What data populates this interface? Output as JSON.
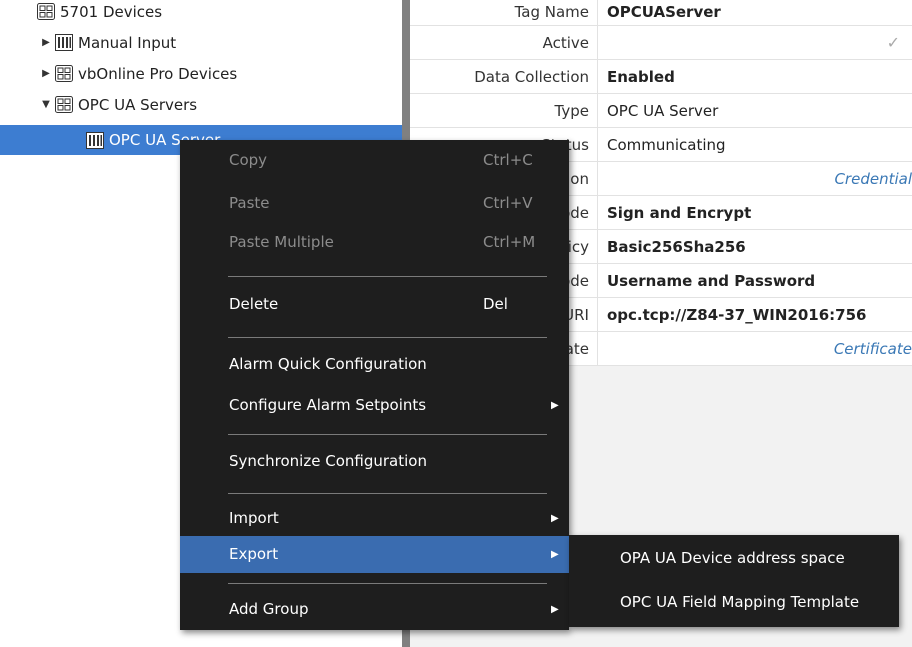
{
  "tree": {
    "items": [
      {
        "label": "5701 Devices",
        "arrow": "",
        "icon": "grid-device-icon"
      },
      {
        "label": "Manual Input",
        "arrow": "▶",
        "icon": "rack-device-icon"
      },
      {
        "label": "vbOnline Pro Devices",
        "arrow": "▶",
        "icon": "grid-device-icon"
      },
      {
        "label": "OPC UA Servers",
        "arrow": "▼",
        "icon": "grid-device-icon"
      },
      {
        "label": "OPC UA Server",
        "arrow": "",
        "icon": "rack-device-icon",
        "selected": true
      }
    ]
  },
  "properties": {
    "rows": [
      {
        "name": "Tag Name",
        "value": "OPCUAServer",
        "style": "bold"
      },
      {
        "name": "Active",
        "value": "✓",
        "style": "check"
      },
      {
        "name": "Data Collection",
        "value": "Enabled",
        "style": "bold"
      },
      {
        "name": "Type",
        "value": "OPC UA Server",
        "style": "normal"
      },
      {
        "name": "Status",
        "value": "Communicating",
        "style": "normal"
      },
      {
        "name": "Authentication",
        "value": "Credential",
        "style": "link"
      },
      {
        "name": "Security Mode",
        "value": "Sign and Encrypt",
        "style": "bold"
      },
      {
        "name": "Security Policy",
        "value": "Basic256Sha256",
        "style": "bold"
      },
      {
        "name": "Authentication Mode",
        "value": "Username and Password",
        "style": "bold"
      },
      {
        "name": "Server URI",
        "value": "opc.tcp://Z84-37_WIN2016:756",
        "style": "bold"
      },
      {
        "name": "Certificate",
        "value": "Certificate",
        "style": "link"
      }
    ],
    "visible_name_fragments": [
      "Tag Name",
      "Active",
      "Data Collection",
      "Type",
      "us",
      "on",
      "de",
      "cy",
      "de",
      "RI",
      "ate"
    ]
  },
  "context_menu": {
    "items": [
      {
        "label": "Copy",
        "shortcut": "Ctrl+C",
        "disabled": true
      },
      {
        "label": "Paste",
        "shortcut": "Ctrl+V",
        "disabled": true
      },
      {
        "label": "Paste Multiple",
        "shortcut": "Ctrl+M",
        "disabled": true
      },
      {
        "label": "Delete",
        "shortcut": "Del"
      },
      {
        "label": "Alarm Quick Configuration"
      },
      {
        "label": "Configure Alarm Setpoints",
        "submenu": true
      },
      {
        "label": "Synchronize Configuration"
      },
      {
        "label": "Import",
        "submenu": true
      },
      {
        "label": "Export",
        "submenu": true,
        "active": true
      },
      {
        "label": "Add Group",
        "submenu": true
      }
    ],
    "submenu_arrow": "▶"
  },
  "export_submenu": {
    "items": [
      {
        "label": "OPA UA Device address space"
      },
      {
        "label": "OPC UA Field Mapping Template"
      }
    ]
  },
  "colors": {
    "selection": "#3d7dd1",
    "menu_bg": "#1e1e1e",
    "menu_active": "#3a6cb0",
    "splitter": "#808080",
    "link": "#3a78b5"
  }
}
